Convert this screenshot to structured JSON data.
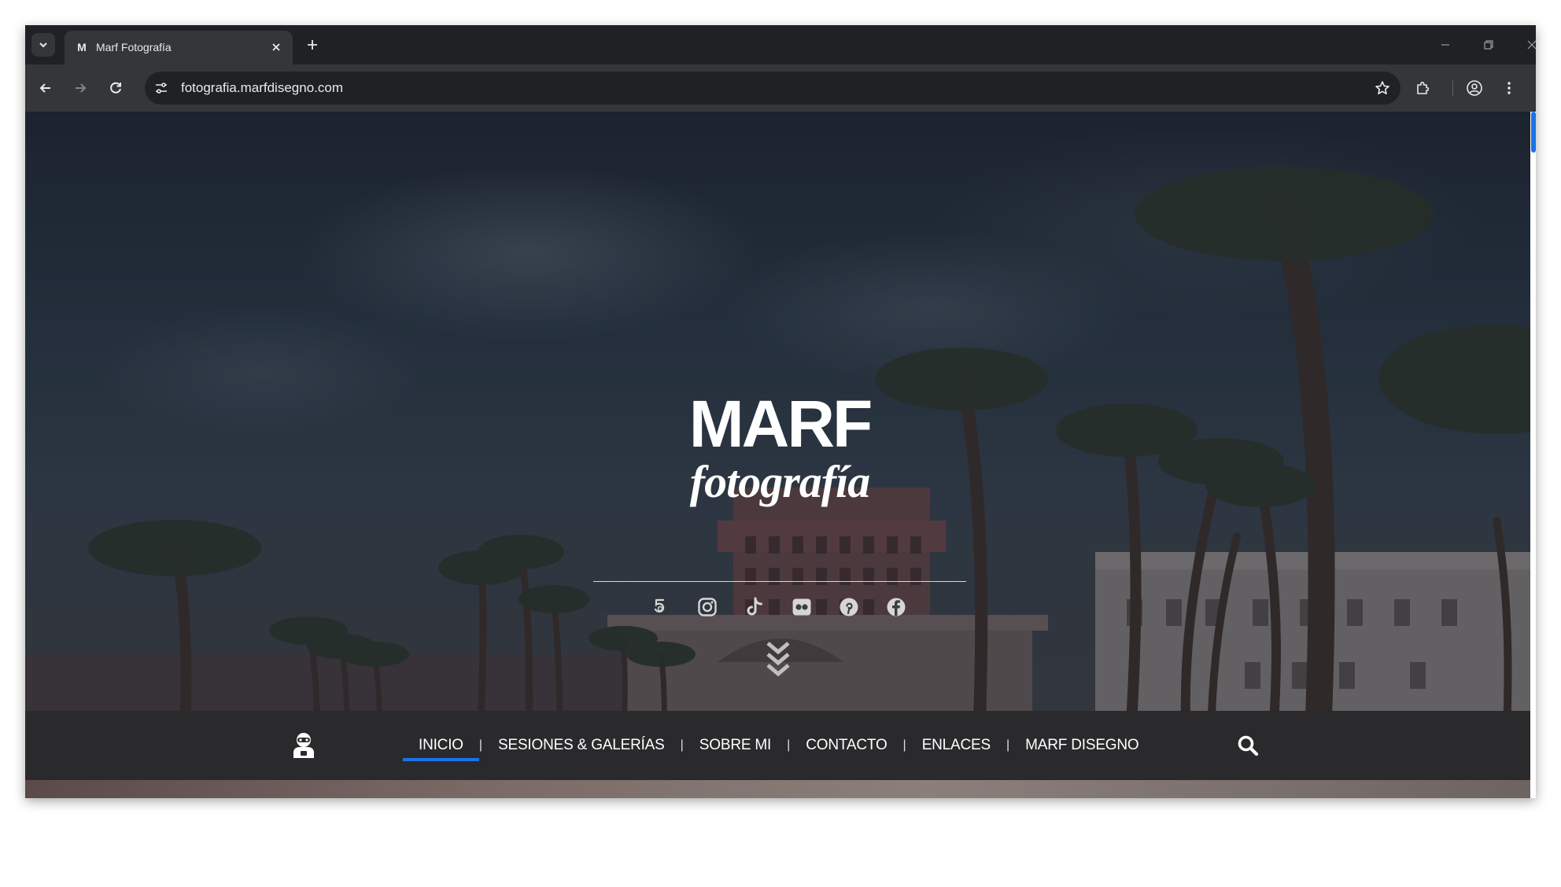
{
  "browser": {
    "tab": {
      "favicon": "M",
      "title": "Marf Fotografía"
    },
    "url": "fotografia.marfdisegno.com",
    "icons": {
      "tab_search": "chevron-down-icon",
      "tab_close": "close-icon",
      "new_tab": "plus-icon",
      "back": "arrow-left-icon",
      "forward": "arrow-right-icon",
      "reload": "reload-icon",
      "site_info": "tune-icon",
      "bookmark": "star-icon",
      "extensions": "puzzle-icon",
      "profile": "account-circle-icon",
      "menu": "kebab-menu-icon",
      "minimize": "minimize-icon",
      "restore": "restore-icon",
      "close_window": "close-icon"
    }
  },
  "hero": {
    "logo_text_top": "MARF",
    "logo_text_bottom": "fotografía",
    "social_icons": [
      "500px-icon",
      "instagram-icon",
      "tiktok-icon",
      "flickr-icon",
      "pinterest-icon",
      "facebook-icon"
    ]
  },
  "nav": {
    "items": [
      {
        "label": "INICIO",
        "active": true
      },
      {
        "label": "SESIONES & GALERÍAS",
        "active": false
      },
      {
        "label": "SOBRE MI",
        "active": false
      },
      {
        "label": "CONTACTO",
        "active": false
      },
      {
        "label": "ENLACES",
        "active": false
      },
      {
        "label": "MARF DISEGNO",
        "active": false
      }
    ],
    "separator": "|",
    "accent_color": "#1a73e8"
  },
  "colors": {
    "browser_frame": "#202124",
    "toolbar": "#35363a",
    "navbar": "#2a2a2c",
    "scroll_thumb": "#1a73e8"
  }
}
